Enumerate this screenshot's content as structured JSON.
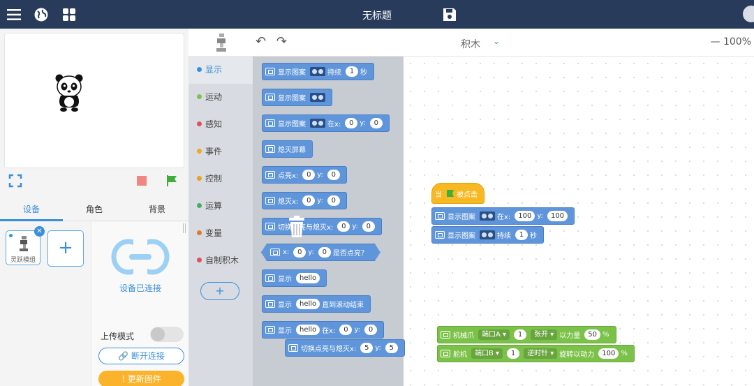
{
  "topbar": {
    "title": "无标题",
    "icons": [
      "menu-icon",
      "globe-icon",
      "apps-grid-icon",
      "save-icon",
      "user-avatar"
    ]
  },
  "stage": {
    "sprite": "panda"
  },
  "tabs": [
    "设备",
    "角色",
    "背景"
  ],
  "device": {
    "name": "灵跃模组",
    "status": "设备已连接",
    "upload_mode_label": "上传模式",
    "upload_mode_on": false,
    "disconnect_label": "断开连接",
    "update_firmware_label": "更新固件"
  },
  "toolbar": {
    "mode": "积木",
    "zoom": "— 100%"
  },
  "categories": [
    {
      "label": "显示",
      "color": "#3b8fd9",
      "active": true
    },
    {
      "label": "运动",
      "color": "#7cc24a"
    },
    {
      "label": "感知",
      "color": "#e0505a"
    },
    {
      "label": "事件",
      "color": "#f2a71c"
    },
    {
      "label": "控制",
      "color": "#e5a323"
    },
    {
      "label": "运算",
      "color": "#44b05c"
    },
    {
      "label": "变量",
      "color": "#e07a2c"
    },
    {
      "label": "自制积木",
      "color": "#e0505a"
    }
  ],
  "category_add": "+",
  "flyout": [
    {
      "parts": [
        "icon",
        "t:显示图案",
        "eyes",
        "t:持续",
        "p:1",
        "t:秒"
      ]
    },
    {
      "parts": [
        "icon",
        "t:显示图案",
        "eyes"
      ]
    },
    {
      "parts": [
        "icon",
        "t:显示图案",
        "eyes",
        "t:在x:",
        "p:0",
        "t:y:",
        "p:0"
      ]
    },
    {
      "parts": [
        "icon",
        "t:熄灭屏幕"
      ]
    },
    {
      "parts": [
        "icon",
        "t:点亮x:",
        "p:0",
        "t:y:",
        "p:0"
      ]
    },
    {
      "parts": [
        "icon",
        "t:熄灭x:",
        "p:0",
        "t:y:",
        "p:0"
      ]
    },
    {
      "parts": [
        "icon",
        "t:切换点亮与熄灭x:",
        "p:0",
        "t:y:",
        "p:0"
      ]
    },
    {
      "parts": [
        "icon",
        "t:x:",
        "p:0",
        "t:y:",
        "p:0",
        "t:是否点亮？"
      ],
      "shape": "hex"
    },
    {
      "parts": [
        "icon",
        "t:显示",
        "p:hello"
      ]
    },
    {
      "parts": [
        "icon",
        "t:显示",
        "p:hello",
        "t:直到滚动结束"
      ]
    },
    {
      "parts": [
        "icon",
        "t:显示",
        "p:hello",
        "t:在x:",
        "p:0",
        "t:y:",
        "p:0"
      ]
    }
  ],
  "dragging": {
    "parts": [
      "icon",
      "t:切换点亮与熄灭x:",
      "p:5",
      "t:y:",
      "p:5"
    ]
  },
  "script1": [
    {
      "parts": [
        "t:当",
        "flag",
        "t:被点击"
      ],
      "kind": "hat"
    },
    {
      "parts": [
        "icon",
        "t:显示图案",
        "eyes",
        "t:在x:",
        "p:100",
        "t:y:",
        "p:100"
      ]
    },
    {
      "parts": [
        "icon",
        "t:显示图案",
        "eyes",
        "t:持续",
        "p:1",
        "t:秒"
      ]
    }
  ],
  "script2": [
    {
      "parts": [
        "icon",
        "t:机械爪",
        "d:端口A ▾",
        "p:1",
        "d:张开 ▾",
        "t:以力量",
        "p:50",
        "t:%"
      ]
    },
    {
      "parts": [
        "icon",
        "t:舵机",
        "d:端口B ▾",
        "p:1",
        "d:逆时针 ▾",
        "t:旋转以动力",
        "p:100",
        "t:%"
      ]
    }
  ]
}
